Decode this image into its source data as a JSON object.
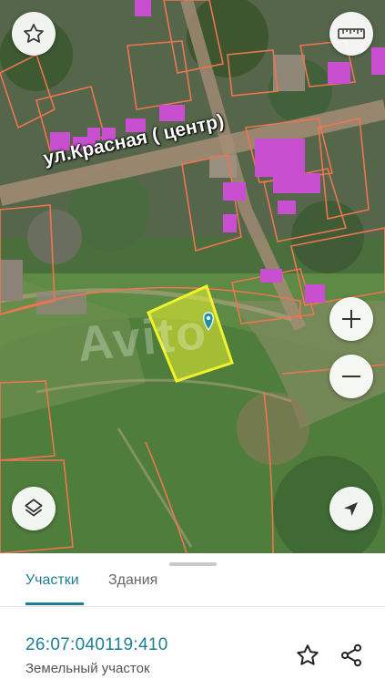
{
  "map": {
    "street_label": "ул.Красная ( центр)",
    "watermark": "Avito",
    "controls": {
      "favorite_icon": "star-outline-icon",
      "ruler_icon": "ruler-icon",
      "zoom_in_icon": "plus-icon",
      "zoom_out_icon": "minus-icon",
      "layers_icon": "layers-icon",
      "locate_icon": "navigation-arrow-icon"
    },
    "colors": {
      "parcel_border": "#ee7550",
      "selected_parcel_fill": "#eaf230",
      "building_highlight": "#c94fd1",
      "marker": "#1f8fa5"
    }
  },
  "sheet": {
    "tabs": [
      {
        "label": "Участки",
        "active": true
      },
      {
        "label": "Здания",
        "active": false
      }
    ],
    "parcel": {
      "cadastral_number": "26:07:040119:410",
      "type": "Земельный участок"
    },
    "actions": {
      "favorite_icon": "star-outline-icon",
      "share_icon": "share-icon"
    }
  }
}
